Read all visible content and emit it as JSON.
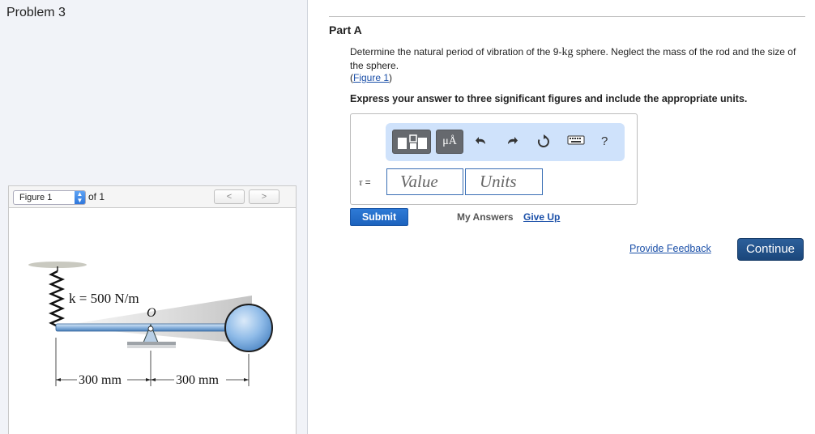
{
  "problem": {
    "title": "Problem 3"
  },
  "figure_panel": {
    "selected": "Figure 1",
    "of_label": "of 1",
    "prev_label": "<",
    "next_label": ">",
    "diagram": {
      "spring_label": "k = 500 N/m",
      "pivot_label": "O",
      "dim_left": "300 mm",
      "dim_right": "300 mm"
    }
  },
  "part": {
    "title": "Part A",
    "question_pre": "Determine the natural period of vibration of the 9-",
    "question_unit": "kg",
    "question_post": " sphere. Neglect the mass of the rod and the size of the sphere.",
    "figure_link_open": "(",
    "figure_link": "Figure 1",
    "figure_link_close": ")",
    "instructions": "Express your answer to three significant figures and include the appropriate units."
  },
  "answer": {
    "toolbar": {
      "units_button": "μÅ",
      "undo_icon": "undo-icon",
      "redo_icon": "redo-icon",
      "reset_icon": "reset-icon",
      "keyboard_icon": "keyboard-icon",
      "help_label": "?"
    },
    "variable_symbol": "τ",
    "equals": " =",
    "value_placeholder": "Value",
    "units_placeholder": "Units"
  },
  "actions": {
    "submit": "Submit",
    "my_answers": "My Answers",
    "give_up": "Give Up",
    "provide_feedback": "Provide Feedback",
    "continue": "Continue"
  },
  "colors": {
    "accent_blue": "#1d63be",
    "link_blue": "#1a4fa8",
    "toolbar_bg": "#cfe2fb",
    "continue_bg": "#1b477b",
    "sphere": "#7fb0e3"
  }
}
